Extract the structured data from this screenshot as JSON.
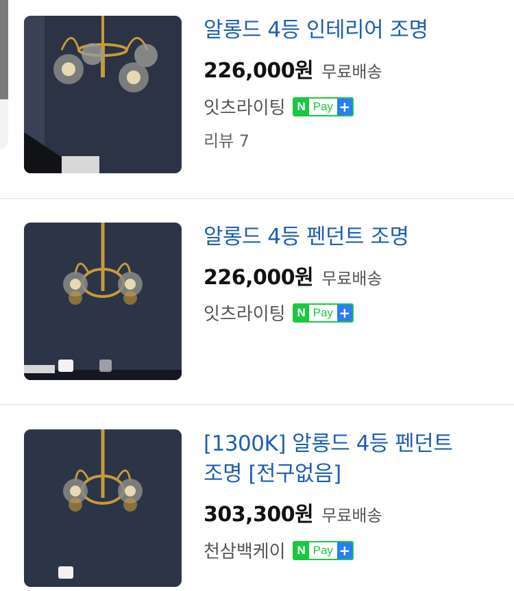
{
  "products": [
    {
      "title": "알롱드 4등 인테리어 조명",
      "price": "226,000원",
      "shipping": "무료배송",
      "store": "잇츠라이팅",
      "npay": {
        "n": "N",
        "pay": "Pay",
        "plus": "+"
      },
      "review": "리뷰 7"
    },
    {
      "title": "알롱드 4등 펜던트 조명",
      "price": "226,000원",
      "shipping": "무료배송",
      "store": "잇츠라이팅",
      "npay": {
        "n": "N",
        "pay": "Pay",
        "plus": "+"
      }
    },
    {
      "title_line1": "[1300K] 알롱드 4등 펜던트",
      "title_line2": "조명 [전구없음]",
      "price": "303,300원",
      "shipping": "무료배송",
      "store": "천삼백케이",
      "npay": {
        "n": "N",
        "pay": "Pay",
        "plus": "+"
      }
    }
  ],
  "colors": {
    "title": "#1c5fb0",
    "npay_green": "#19c840",
    "npay_plus_blue": "#2a7df4",
    "thumb_bg": "#2c3447"
  }
}
